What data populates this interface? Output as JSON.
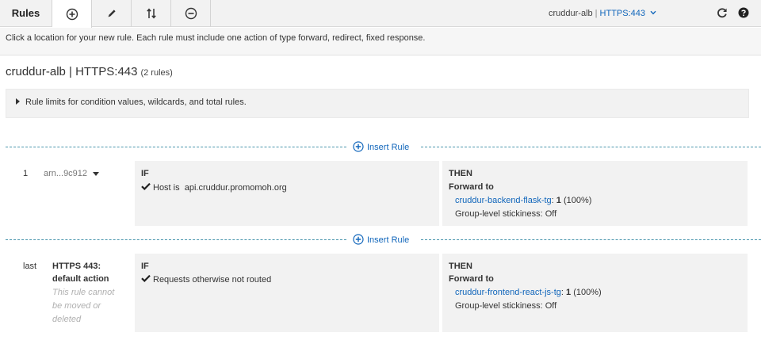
{
  "toolbar": {
    "title": "Rules",
    "buttons": [
      {
        "name": "add-rules",
        "icon": "plus-circle-icon",
        "active": true
      },
      {
        "name": "edit-rules",
        "icon": "pencil-icon",
        "active": false
      },
      {
        "name": "reorder-rules",
        "icon": "reorder-arrows-icon",
        "active": false
      },
      {
        "name": "delete-rules",
        "icon": "minus-circle-icon",
        "active": false
      }
    ],
    "load_balancer": "cruddur-alb",
    "listener": "HTTPS:443",
    "refresh_icon": "refresh-icon",
    "help_icon": "help-icon"
  },
  "hint": "Click a location for your new rule. Each rule must include one action of type forward, redirect, fixed response.",
  "page": {
    "title": "cruddur-alb | HTTPS:443",
    "rule_count": "(2 rules)",
    "limits_label": "Rule limits for condition values, wildcards, and total rules."
  },
  "insert_label": "Insert Rule",
  "rules": [
    {
      "number": "1",
      "arn": "arn...9c912",
      "if_label": "IF",
      "condition": "Host is  api.cruddur.promomoh.org",
      "then_label": "THEN",
      "action": "Forward to",
      "target_group": "cruddur-backend-flask-tg",
      "weight": "1",
      "percent": "(100%)",
      "stickiness": "Group-level stickiness: Off"
    },
    {
      "number": "last",
      "title_line1": "HTTPS 443:",
      "title_line2": "default action",
      "note": [
        "This rule cannot",
        "be moved or",
        "deleted"
      ],
      "if_label": "IF",
      "condition": "Requests otherwise not routed",
      "then_label": "THEN",
      "action": "Forward to",
      "target_group": "cruddur-frontend-react-js-tg",
      "weight": "1",
      "percent": "(100%)",
      "stickiness": "Group-level stickiness: Off"
    }
  ]
}
